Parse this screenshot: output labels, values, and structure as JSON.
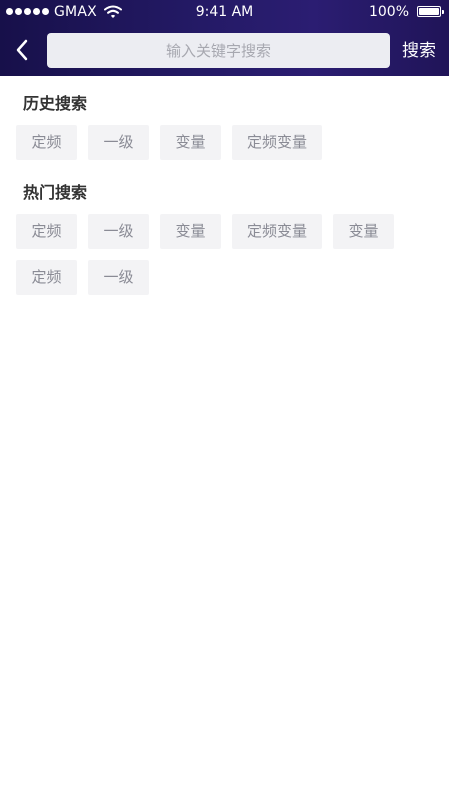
{
  "status_bar": {
    "carrier": "GMAX",
    "time": "9:41 AM",
    "battery": "100%"
  },
  "header": {
    "back_icon": "chevron-left-icon",
    "search_placeholder": "输入关键字搜索",
    "search_label": "搜索"
  },
  "history": {
    "title": "历史搜索",
    "tags": [
      "定频",
      "一级",
      "变量",
      "定频变量"
    ]
  },
  "hot": {
    "title": "热门搜索",
    "tags": [
      "定频",
      "一级",
      "变量",
      "定频变量",
      "变量",
      "定频",
      "一级"
    ]
  },
  "colors": {
    "header_gradient_start": "#17104a",
    "header_gradient_end": "#2b1d72",
    "tag_background": "#f3f3f5",
    "tag_text": "#8a8b95",
    "title_text": "#333333"
  }
}
